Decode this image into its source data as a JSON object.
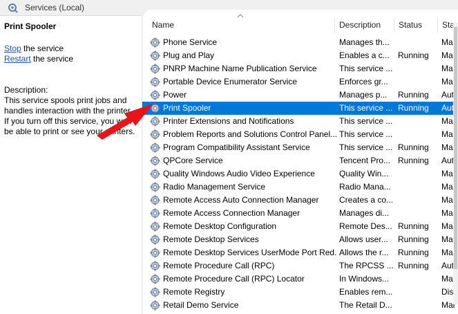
{
  "window": {
    "title": "Services (Local)"
  },
  "left_pane": {
    "service_title": "Print Spooler",
    "actions": [
      {
        "link": "Stop",
        "rest": " the service"
      },
      {
        "link": "Restart",
        "rest": " the service"
      }
    ],
    "description_heading": "Description:",
    "description": "This service spools print jobs and handles interaction with the printer. If you turn off this service, you won't be able to print or see your printers."
  },
  "columns": {
    "name": "Name",
    "description": "Description",
    "status": "Status",
    "startup": "Star"
  },
  "services": [
    {
      "name": "Phone Service",
      "description": "Manages th...",
      "status": "",
      "startup": "Mar"
    },
    {
      "name": "Plug and Play",
      "description": "Enables a c...",
      "status": "Running",
      "startup": "Mar"
    },
    {
      "name": "PNRP Machine Name Publication Service",
      "description": "This service ...",
      "status": "",
      "startup": "Mar"
    },
    {
      "name": "Portable Device Enumerator Service",
      "description": "Enforces gr...",
      "status": "",
      "startup": "Mar"
    },
    {
      "name": "Power",
      "description": "Manages p...",
      "status": "Running",
      "startup": "Auto"
    },
    {
      "name": "Print Spooler",
      "description": "This service ...",
      "status": "Running",
      "startup": "Auto",
      "selected": true
    },
    {
      "name": "Printer Extensions and Notifications",
      "description": "This service ...",
      "status": "",
      "startup": "Mar"
    },
    {
      "name": "Problem Reports and Solutions Control Panel...",
      "description": "This service ...",
      "status": "",
      "startup": "Mar"
    },
    {
      "name": "Program Compatibility Assistant Service",
      "description": "This service ...",
      "status": "Running",
      "startup": "Mar"
    },
    {
      "name": "QPCore Service",
      "description": "Tencent Pro...",
      "status": "Running",
      "startup": "Auto"
    },
    {
      "name": "Quality Windows Audio Video Experience",
      "description": "Quality Win...",
      "status": "",
      "startup": "Mar"
    },
    {
      "name": "Radio Management Service",
      "description": "Radio Mana...",
      "status": "",
      "startup": "Mar"
    },
    {
      "name": "Remote Access Auto Connection Manager",
      "description": "Creates a co...",
      "status": "",
      "startup": "Mar"
    },
    {
      "name": "Remote Access Connection Manager",
      "description": "Manages di...",
      "status": "",
      "startup": "Mar"
    },
    {
      "name": "Remote Desktop Configuration",
      "description": "Remote Des...",
      "status": "Running",
      "startup": "Mar"
    },
    {
      "name": "Remote Desktop Services",
      "description": "Allows user...",
      "status": "Running",
      "startup": "Mar"
    },
    {
      "name": "Remote Desktop Services UserMode Port Red...",
      "description": "Allows the r...",
      "status": "Running",
      "startup": "Mar"
    },
    {
      "name": "Remote Procedure Call (RPC)",
      "description": "The RPCSS ...",
      "status": "Running",
      "startup": "Auto"
    },
    {
      "name": "Remote Procedure Call (RPC) Locator",
      "description": "In Windows...",
      "status": "",
      "startup": "Mar"
    },
    {
      "name": "Remote Registry",
      "description": "Enables rem...",
      "status": "",
      "startup": "Disa"
    },
    {
      "name": "Retail Demo Service",
      "description": "The Retail D...",
      "status": "",
      "startup": "Mar"
    }
  ],
  "colors": {
    "selection": "#0078d7",
    "link": "#1a54b4",
    "annotation_arrow": "#e8141c"
  },
  "icons": {
    "window": "services-gear-icon",
    "row": "service-gear-icon",
    "sort": "sort-ascending-icon",
    "annotation": "red-pointer-arrow-icon"
  }
}
